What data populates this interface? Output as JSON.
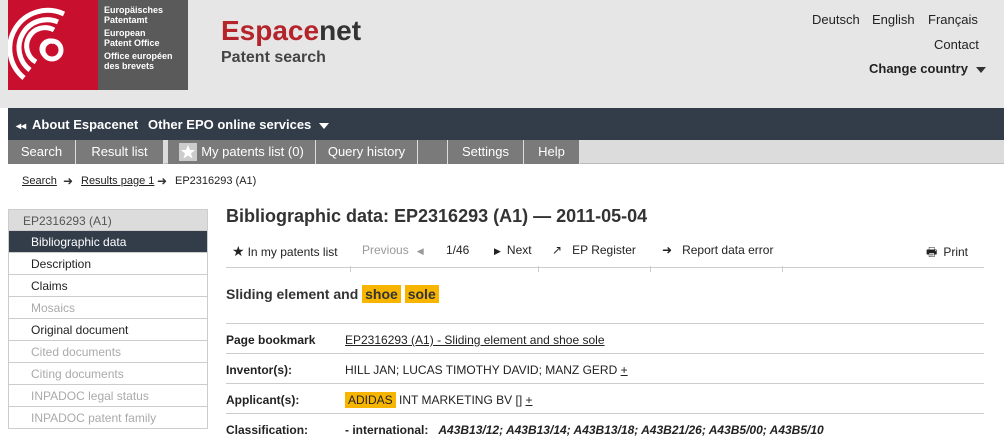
{
  "epo": {
    "org_de_1": "Europäisches",
    "org_de_2": "Patentamt",
    "org_en_1": "European",
    "org_en_2": "Patent Office",
    "org_fr_1": "Office européen",
    "org_fr_2": "des brevets"
  },
  "brand": {
    "espace": "Espace",
    "net": "net",
    "subtitle": "Patent search"
  },
  "header_links": {
    "deutsch": "Deutsch",
    "english": "English",
    "francais": "Français",
    "contact": "Contact",
    "change_country": "Change country"
  },
  "darknav": {
    "about": "About Espacenet",
    "other": "Other EPO online services"
  },
  "tabs": {
    "search": "Search",
    "result_list": "Result list",
    "my_patents": "My patents list (0)",
    "query_history": "Query history",
    "settings": "Settings",
    "help": "Help"
  },
  "breadcrumb": {
    "search": "Search",
    "results": "Results page 1",
    "current": "EP2316293 (A1)"
  },
  "sidebar": {
    "title": "EP2316293  (A1)",
    "items": [
      "Bibliographic data",
      "Description",
      "Claims",
      "Mosaics",
      "Original document",
      "Cited documents",
      "Citing documents",
      "INPADOC legal status",
      "INPADOC patent family"
    ]
  },
  "main": {
    "title": "Bibliographic data: EP2316293  (A1) — 2011-05-04",
    "actions": {
      "in_my_patents": "In my patents list",
      "previous": "Previous",
      "pager": "1/46",
      "next": "Next",
      "ep_register": "EP Register",
      "report": "Report data error",
      "print": "Print"
    },
    "doc_title": {
      "part1": "Sliding element and ",
      "hl1": "shoe",
      "hl2": "sole"
    },
    "rows": {
      "bookmark_label": "Page bookmark",
      "bookmark_value": "EP2316293  (A1)  -  Sliding element and shoe sole",
      "inventors_label": "Inventor(s):",
      "inventors_value": "HILL JAN; LUCAS TIMOTHY DAVID; MANZ GERD",
      "inventors_more": "+",
      "applicants_label": "Applicant(s):",
      "applicants_hl": "ADIDAS",
      "applicants_rest": " INT MARKETING BV []",
      "applicants_more": "+",
      "classification_label": "Classification:",
      "classification_intl": "- international:",
      "classification_codes": "A43B13/12; A43B13/14; A43B13/18; A43B21/26; A43B5/00; A43B5/10"
    }
  },
  "colors": {
    "epo_red": "#c8102e",
    "nav_dark": "#333d49",
    "highlight": "#f7b500"
  }
}
